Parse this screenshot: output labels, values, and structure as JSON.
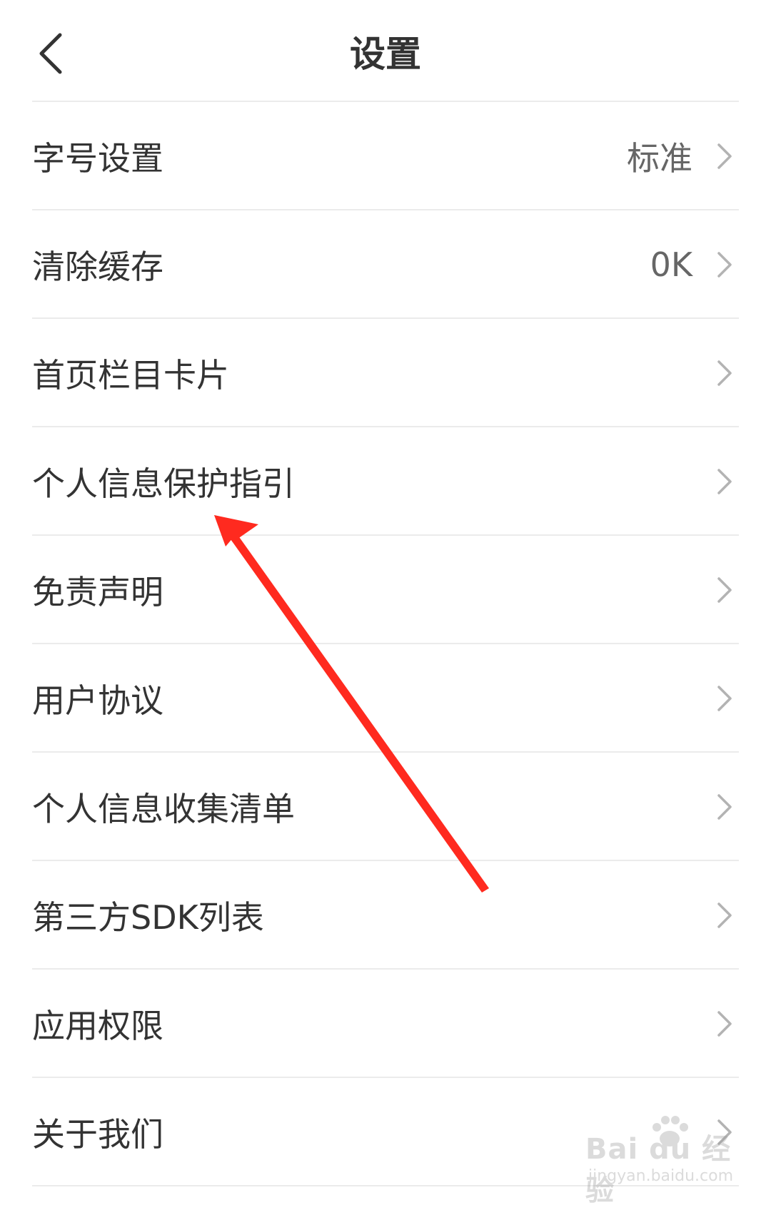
{
  "header": {
    "title": "设置",
    "back_icon": "chevron-left-icon"
  },
  "settings": {
    "items": [
      {
        "id": "font-size",
        "label": "字号设置",
        "value": "标准"
      },
      {
        "id": "clear-cache",
        "label": "清除缓存",
        "value": "0K"
      },
      {
        "id": "home-cards",
        "label": "首页栏目卡片",
        "value": ""
      },
      {
        "id": "privacy-guide",
        "label": "个人信息保护指引",
        "value": ""
      },
      {
        "id": "disclaimer",
        "label": "免责声明",
        "value": ""
      },
      {
        "id": "user-agreement",
        "label": "用户协议",
        "value": ""
      },
      {
        "id": "info-collection",
        "label": "个人信息收集清单",
        "value": ""
      },
      {
        "id": "sdk-list",
        "label": "第三方SDK列表",
        "value": ""
      },
      {
        "id": "app-permissions",
        "label": "应用权限",
        "value": ""
      },
      {
        "id": "about-us",
        "label": "关于我们",
        "value": ""
      }
    ],
    "chevron_icon": "chevron-right-icon"
  },
  "annotation": {
    "arrow_color": "#ff2a1f",
    "arrow_icon": "red-arrow-annotation"
  },
  "watermark": {
    "logo_text": "Bai du 经验",
    "url_text": "jingyan.baidu.com"
  },
  "colors": {
    "text_primary": "#333333",
    "text_secondary": "#666666",
    "divider": "#ebebeb",
    "chevron": "#b3b3b3"
  }
}
